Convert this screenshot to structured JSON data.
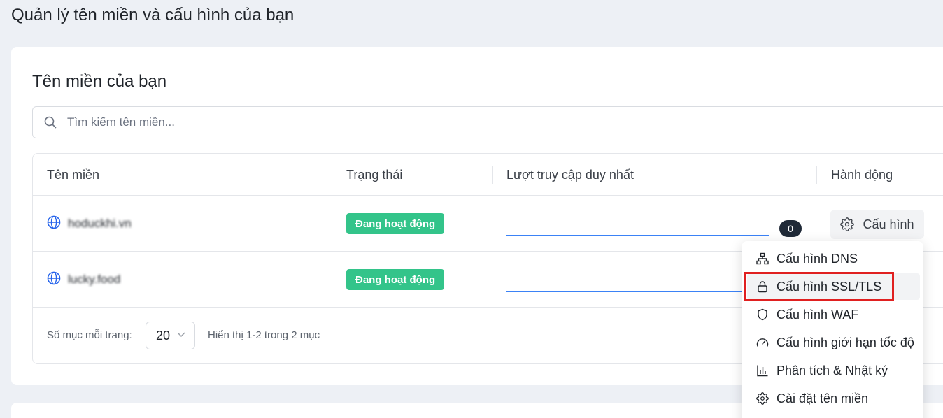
{
  "page": {
    "title": "Quản lý tên miền và cấu hình của bạn"
  },
  "card": {
    "title": "Tên miền của bạn",
    "search": {
      "placeholder": "Tìm kiếm tên miền..."
    },
    "table": {
      "headers": [
        "Tên miền",
        "Trạng thái",
        "Lượt truy cập duy nhất",
        "Hành động"
      ],
      "rows": [
        {
          "domain": "hoduckhi.vn",
          "status": "Đang hoạt động",
          "visits": "0",
          "action": "Cấu hình"
        },
        {
          "domain": "lucky.food",
          "status": "Đang hoạt động",
          "visits": "",
          "action": ""
        }
      ]
    },
    "footer": {
      "per_page_label": "Số mục mỗi trang:",
      "per_page_value": "20",
      "range_info": "Hiển thị 1-2 trong 2 mục"
    }
  },
  "dropdown_menu": {
    "items": [
      {
        "label": "Cấu hình DNS",
        "icon": "sitemap-icon"
      },
      {
        "label": "Cấu hình SSL/TLS",
        "icon": "lock-icon",
        "highlighted": true
      },
      {
        "label": "Cấu hình WAF",
        "icon": "shield-icon"
      },
      {
        "label": "Cấu hình giới hạn tốc độ",
        "icon": "gauge-icon"
      },
      {
        "label": "Phân tích & Nhật ký",
        "icon": "bar-chart-icon"
      },
      {
        "label": "Cài đặt tên miền",
        "icon": "gear-icon"
      }
    ]
  },
  "colors": {
    "status_active": "#33c48a",
    "accent": "#3b82f6",
    "highlight": "#e02020"
  }
}
